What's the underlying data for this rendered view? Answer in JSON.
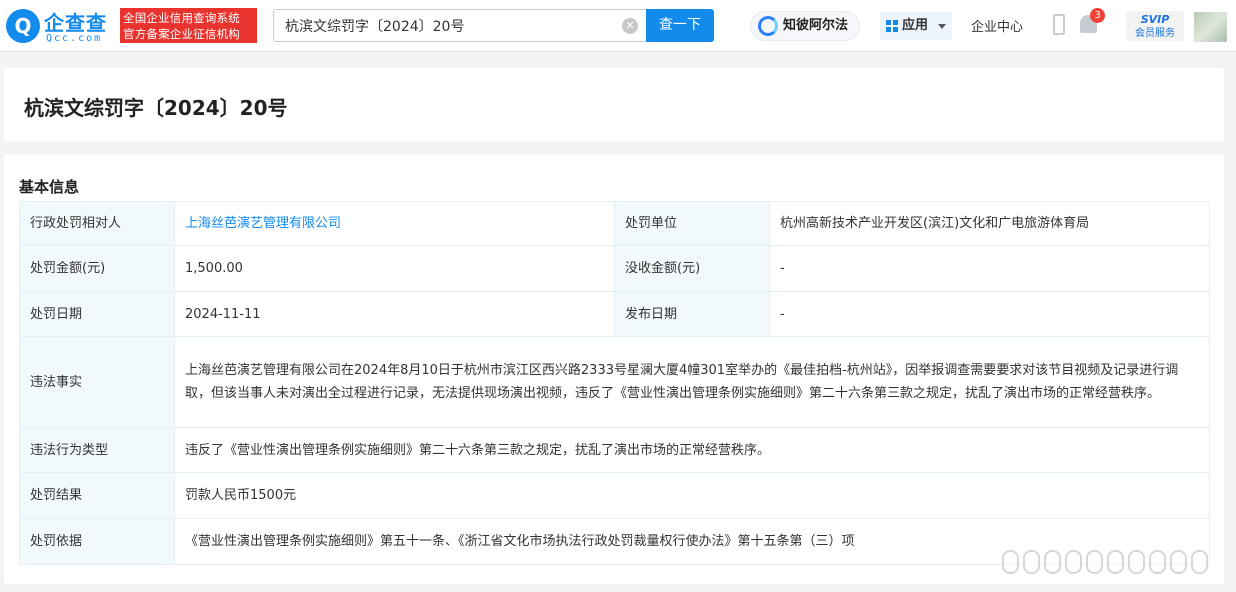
{
  "header": {
    "logo_mark": "Q",
    "logo_cn": "企查查",
    "logo_en": "Qcc.com",
    "slogan_line1": "全国企业信用查询系统",
    "slogan_line2": "官方备案企业征信机构",
    "search_value": "杭滨文综罚字〔2024〕20号",
    "search_button": "查一下",
    "zhibi_label": "知彼阿尔法",
    "apps_label": "应用",
    "enterprise_center": "企业中心",
    "notification_count": "3",
    "svip_label": "SVIP",
    "svip_sub": "会员服务"
  },
  "page_title": "杭滨文综罚字〔2024〕20号",
  "section_title": "基本信息",
  "table": {
    "r1": {
      "l1": "行政处罚相对人",
      "v1": "上海丝芭演艺管理有限公司",
      "l2": "处罚单位",
      "v2": "杭州高新技术产业开发区(滨江)文化和广电旅游体育局"
    },
    "r2": {
      "l1": "处罚金额(元)",
      "v1": "1,500.00",
      "l2": "没收金额(元)",
      "v2": "-"
    },
    "r3": {
      "l1": "处罚日期",
      "v1": "2024-11-11",
      "l2": "发布日期",
      "v2": "-"
    },
    "r4": {
      "l": "违法事实",
      "v": "上海丝芭演艺管理有限公司在2024年8月10日于杭州市滨江区西兴路2333号星澜大厦4幢301室举办的《最佳拍档-杭州站》，因举报调查需要要求对该节目视频及记录进行调取，但该当事人未对演出全过程进行记录，无法提供现场演出视频，违反了《营业性演出管理条例实施细则》第二十六条第三款之规定，扰乱了演出市场的正常经营秩序。"
    },
    "r5": {
      "l": "违法行为类型",
      "v": "违反了《营业性演出管理条例实施细则》第二十六条第三款之规定，扰乱了演出市场的正常经营秩序。"
    },
    "r6": {
      "l": "处罚结果",
      "v": "罚款人民币1500元"
    },
    "r7": {
      "l": "处罚依据",
      "v": "《营业性演出管理条例实施细则》第五十一条、《浙江省文化市场执法行政处罚裁量权行使办法》第十五条第（三）项"
    }
  },
  "colors": {
    "brand": "#128bed",
    "slogan_bg": "#e8332f",
    "label_bg": "#f2f9fc"
  }
}
